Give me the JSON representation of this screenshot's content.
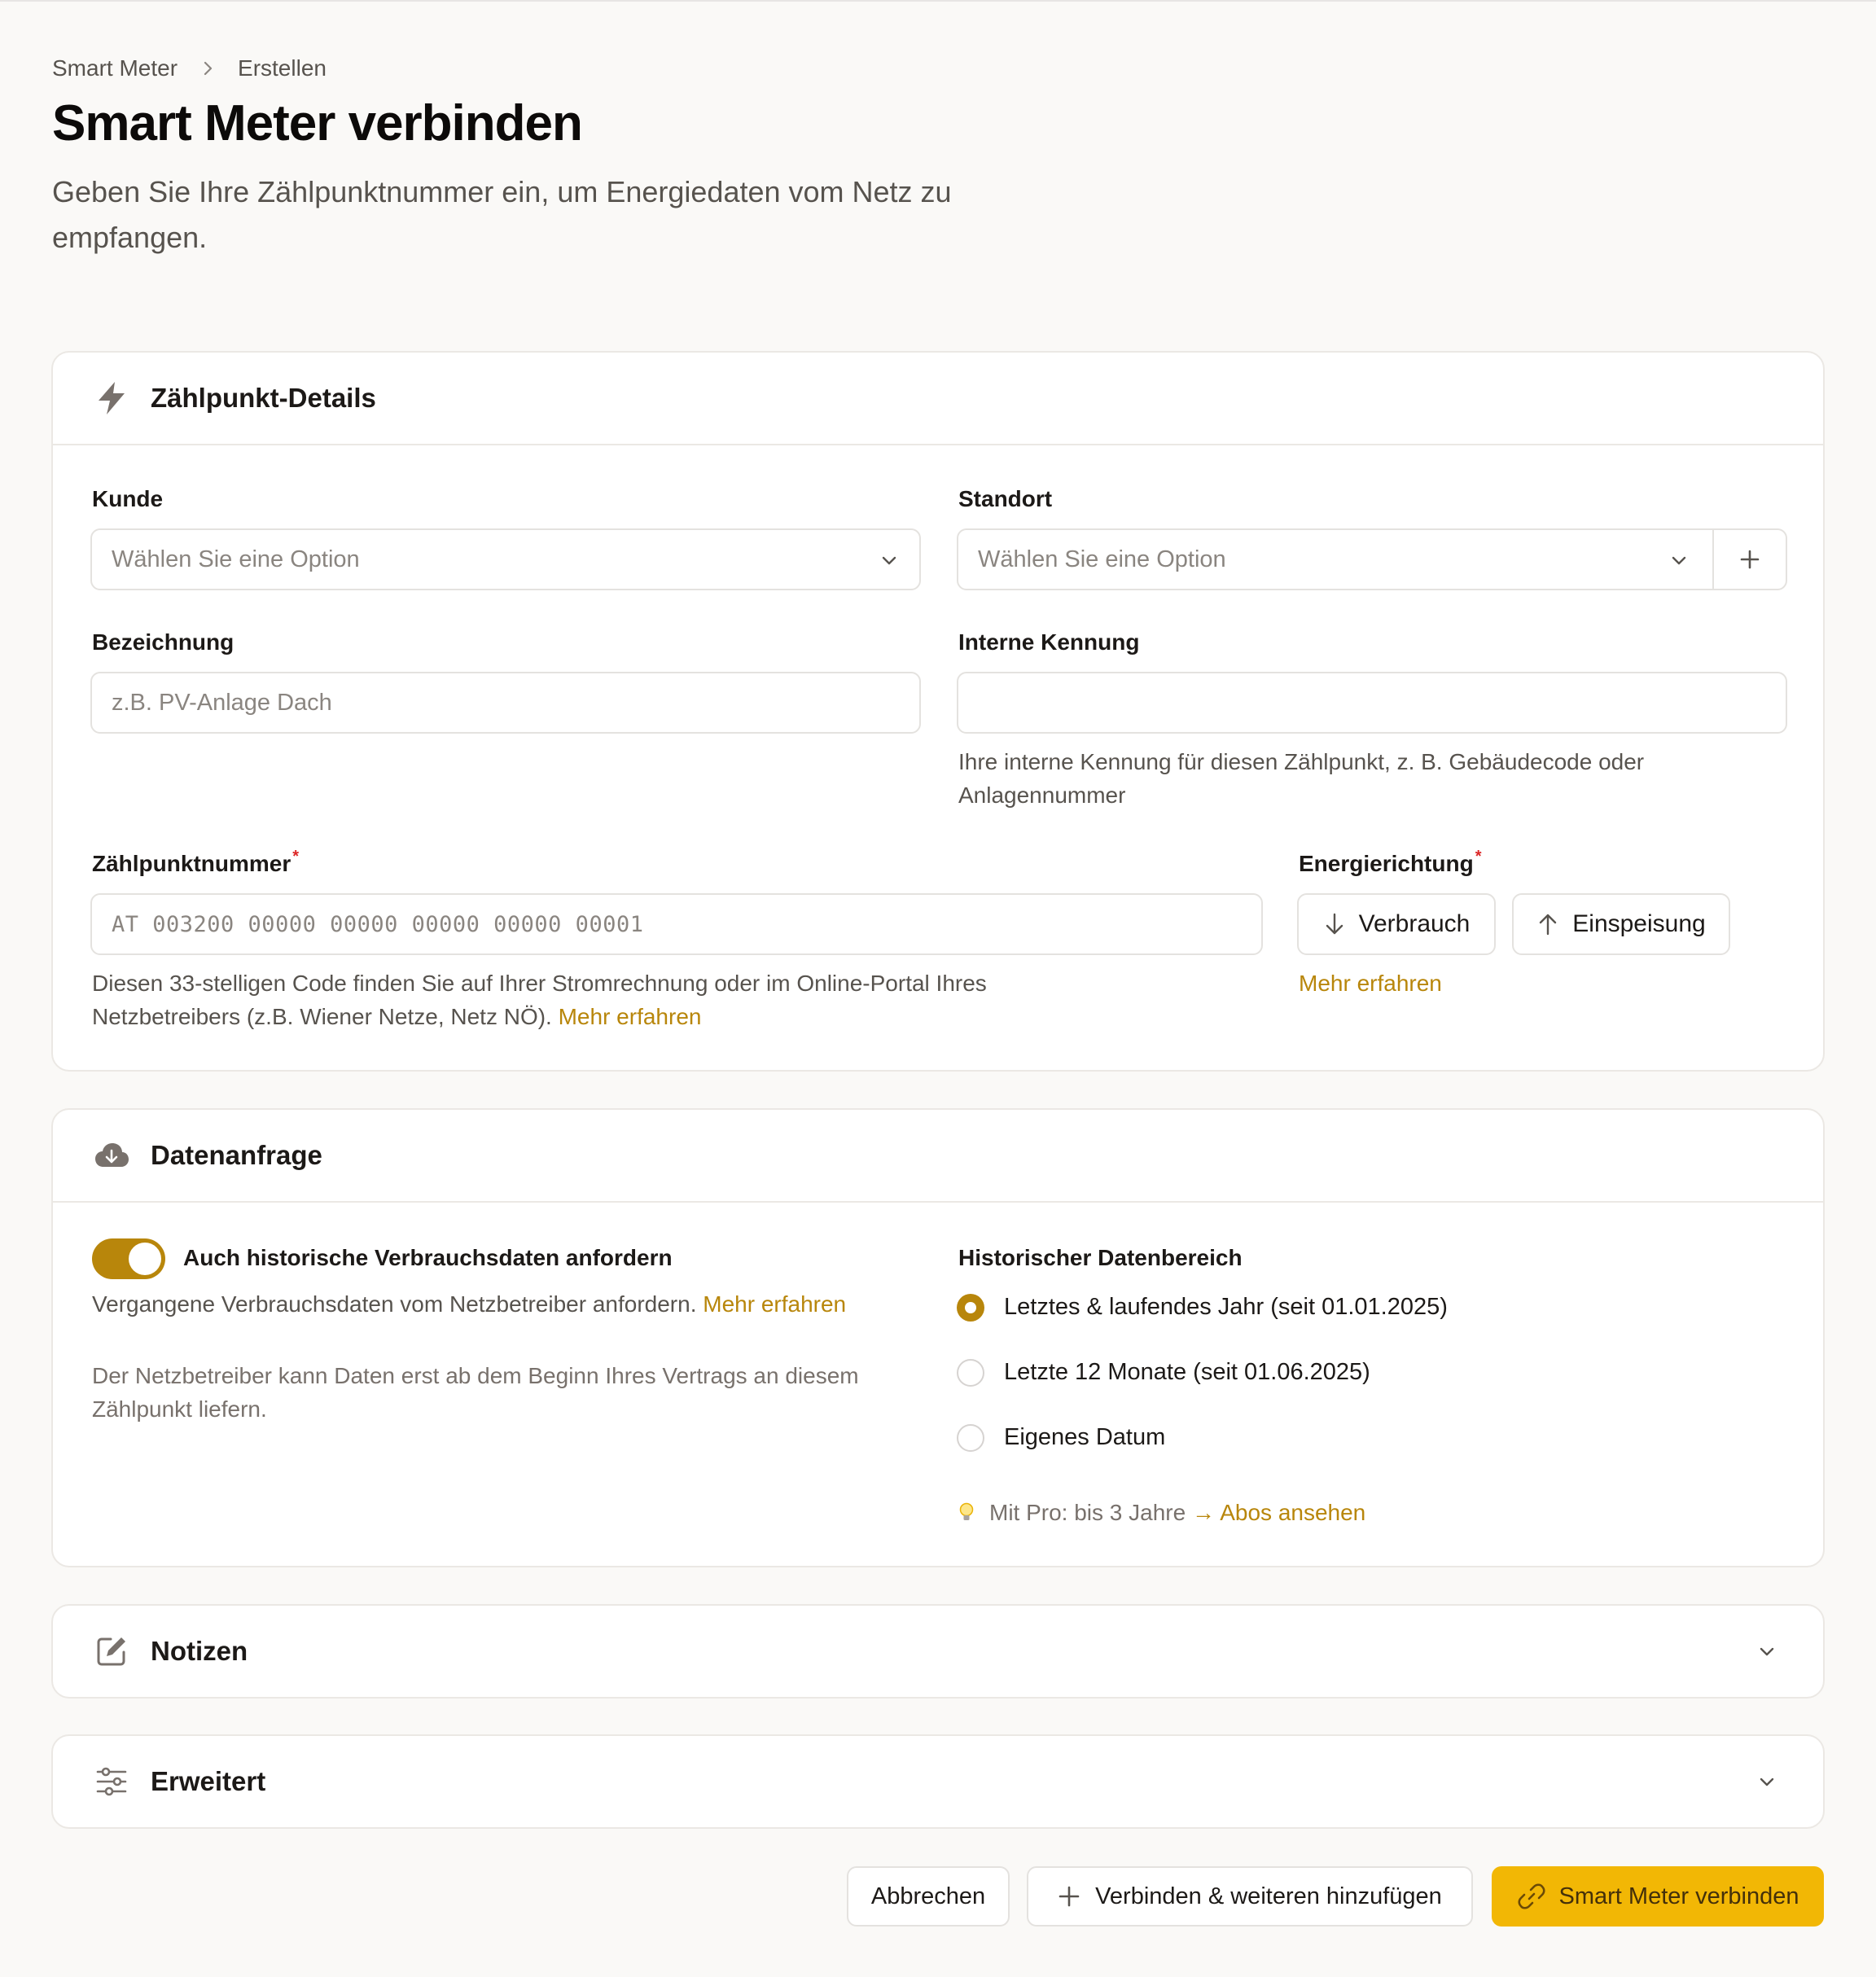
{
  "breadcrumb": {
    "root": "Smart Meter",
    "current": "Erstellen"
  },
  "page": {
    "title": "Smart Meter verbinden",
    "subtitle": "Geben Sie Ihre Zählpunktnummer ein, um Energiedaten vom Netz zu empfangen."
  },
  "details": {
    "title": "Zählpunkt-Details",
    "kunde_label": "Kunde",
    "kunde_placeholder": "Wählen Sie eine Option",
    "standort_label": "Standort",
    "standort_placeholder": "Wählen Sie eine Option",
    "bezeichnung_label": "Bezeichnung",
    "bezeichnung_placeholder": "z.B. PV-Anlage Dach",
    "kennung_label": "Interne Kennung",
    "kennung_value": "",
    "kennung_help": "Ihre interne Kennung für diesen Zählpunkt, z. B. Gebäudecode oder Anlagennummer",
    "zpn_label": "Zählpunktnummer",
    "required_mark": "*",
    "zpn_placeholder": "AT 003200 00000 00000 00000 00000 00001",
    "zpn_help": "Diesen 33-stelligen Code finden Sie auf Ihrer Stromrechnung oder im Online-Portal Ihres Netzbetreibers (z.B. Wiener Netze, Netz NÖ).",
    "zpn_link": "Mehr erfahren",
    "energy_label": "Energierichtung",
    "btn_verbrauch": "Verbrauch",
    "btn_einspeisung": "Einspeisung",
    "energy_link": "Mehr erfahren"
  },
  "datenanfrage": {
    "title": "Datenanfrage",
    "toggle_on": true,
    "toggle_label": "Auch historische Verbrauchsdaten anfordern",
    "toggle_help": "Vergangene Verbrauchsdaten vom Netzbetreiber anfordern.",
    "toggle_link": "Mehr erfahren",
    "note": "Der Netzbetreiber kann Daten erst ab dem Beginn Ihres Vertrags an diesem Zählpunkt liefern.",
    "range_label": "Historischer Datenbereich",
    "options": [
      {
        "label": "Letztes & laufendes Jahr (seit 01.01.2025)",
        "selected": true
      },
      {
        "label": "Letzte 12 Monate (seit 01.06.2025)",
        "selected": false
      },
      {
        "label": "Eigenes Datum",
        "selected": false
      }
    ],
    "pro_hint": "Mit Pro: bis 3 Jahre",
    "pro_link": "→ Abos ansehen"
  },
  "notizen": {
    "title": "Notizen"
  },
  "erweitert": {
    "title": "Erweitert"
  },
  "footer": {
    "cancel": "Abbrechen",
    "add_more": "Verbinden & weiteren hinzufügen",
    "submit": "Smart Meter verbinden"
  },
  "colors": {
    "accent": "#b8860b",
    "primary_button": "#f2b705",
    "required": "#dc2626",
    "background": "#faf9f7"
  },
  "icons": [
    "chevron-right-icon",
    "bolt-icon",
    "chevron-down-icon",
    "plus-icon",
    "arrow-down-icon",
    "arrow-up-icon",
    "cloud-download-icon",
    "lightbulb-icon",
    "edit-icon",
    "sliders-icon",
    "link-icon"
  ]
}
